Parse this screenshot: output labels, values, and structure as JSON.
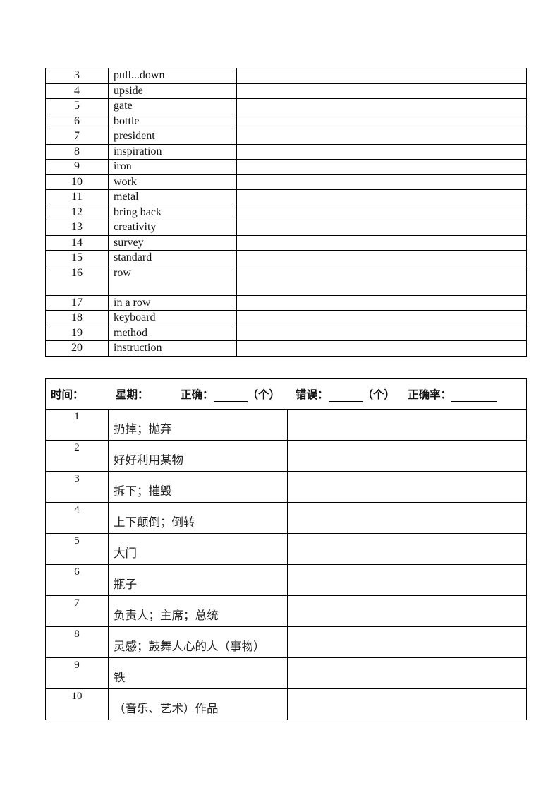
{
  "english_table": {
    "rows": [
      {
        "num": "3",
        "word": "pull...down",
        "answer": ""
      },
      {
        "num": "4",
        "word": "upside",
        "answer": ""
      },
      {
        "num": "5",
        "word": "gate",
        "answer": ""
      },
      {
        "num": "6",
        "word": "bottle",
        "answer": ""
      },
      {
        "num": "7",
        "word": "president",
        "answer": ""
      },
      {
        "num": "8",
        "word": "inspiration",
        "answer": ""
      },
      {
        "num": "9",
        "word": "iron",
        "answer": ""
      },
      {
        "num": "10",
        "word": "work",
        "answer": ""
      },
      {
        "num": "11",
        "word": "metal",
        "answer": ""
      },
      {
        "num": "12",
        "word": "bring back",
        "answer": ""
      },
      {
        "num": "13",
        "word": "creativity",
        "answer": ""
      },
      {
        "num": "14",
        "word": "survey",
        "answer": ""
      },
      {
        "num": "15",
        "word": "standard",
        "answer": ""
      },
      {
        "num": "16",
        "word": "row",
        "answer": ""
      },
      {
        "num": "17",
        "word": "in a row",
        "answer": ""
      },
      {
        "num": "18",
        "word": "keyboard",
        "answer": ""
      },
      {
        "num": "19",
        "word": "method",
        "answer": ""
      },
      {
        "num": "20",
        "word": "instruction",
        "answer": ""
      }
    ]
  },
  "chinese_table": {
    "header": {
      "time_label": "时间：",
      "weekday_label": "星期：",
      "correct_label": "正确：",
      "correct_unit": "（个）",
      "wrong_label": "错误：",
      "wrong_unit": "（个）",
      "accuracy_label": "正确率："
    },
    "rows": [
      {
        "num": "1",
        "meaning": "扔掉；抛弃",
        "answer": ""
      },
      {
        "num": "2",
        "meaning": "好好利用某物",
        "answer": ""
      },
      {
        "num": "3",
        "meaning": "拆下；摧毁",
        "answer": ""
      },
      {
        "num": "4",
        "meaning": "上下颠倒；倒转",
        "answer": ""
      },
      {
        "num": "5",
        "meaning": "大门",
        "answer": ""
      },
      {
        "num": "6",
        "meaning": "瓶子",
        "answer": ""
      },
      {
        "num": "7",
        "meaning": "负责人；主席；总统",
        "answer": ""
      },
      {
        "num": "8",
        "meaning": "灵感；鼓舞人心的人（事物）",
        "answer": ""
      },
      {
        "num": "9",
        "meaning": "铁",
        "answer": ""
      },
      {
        "num": "10",
        "meaning": "（音乐、艺术）作品",
        "answer": ""
      }
    ]
  }
}
